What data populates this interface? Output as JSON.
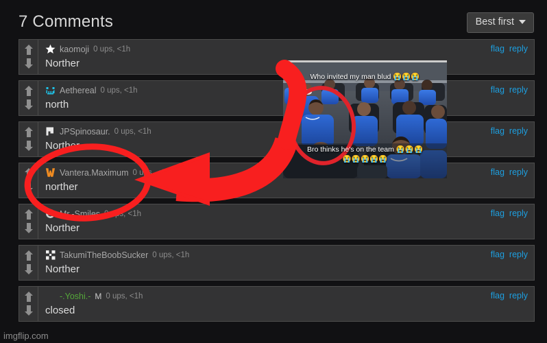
{
  "header": {
    "title": "7 Comments",
    "sort_label": "Best first",
    "sort_icon": "chevron-down-icon"
  },
  "actions": {
    "flag_label": "flag",
    "reply_label": "reply"
  },
  "comments": [
    {
      "username": "kaomoji",
      "avatar_icon": "star-avatar-icon",
      "avatar_color": "#ffffff",
      "score": "0 ups, <1h",
      "text": "Norther",
      "is_mod": false,
      "mod_badge": ""
    },
    {
      "username": "Aethereal",
      "avatar_icon": "pixel-face-avatar-icon",
      "avatar_color": "#1fc3e8",
      "score": "0 ups, <1h",
      "text": "north",
      "is_mod": false,
      "mod_badge": ""
    },
    {
      "username": "JPSpinosaur.",
      "avatar_icon": "flag-block-avatar-icon",
      "avatar_color": "#e8e8e8",
      "score": "0 ups, <1h",
      "text": "Norther",
      "is_mod": false,
      "mod_badge": ""
    },
    {
      "username": "Vantera.Maximum",
      "avatar_icon": "orange-v-avatar-icon",
      "avatar_color": "#ef8b21",
      "score": "0 ups, <1h",
      "text": "norther",
      "is_mod": false,
      "mod_badge": ""
    },
    {
      "username": "Mr.-Smiles",
      "avatar_icon": "smiley-avatar-icon",
      "avatar_color": "#cfcfcf",
      "score": "0 ups, <1h",
      "text": "Norther",
      "is_mod": false,
      "mod_badge": ""
    },
    {
      "username": "TakumiTheBoobSucker",
      "avatar_icon": "plus-cross-avatar-icon",
      "avatar_color": "#f0f0f0",
      "score": "0 ups, <1h",
      "text": "Norther",
      "is_mod": false,
      "mod_badge": ""
    },
    {
      "username": "-.Yoshi.-",
      "avatar_icon": "blank-avatar-icon",
      "avatar_color": "#55a83a",
      "score": "0 ups, <1h",
      "text": "closed",
      "is_mod": true,
      "mod_badge": "M"
    }
  ],
  "meme_overlay": {
    "top_caption": "Who invited my man blud 😭😭😭",
    "bottom_caption": "Bro thinks he's on the team 😭😭😭",
    "bottom_caption_line2": "😭😭😭😭😭",
    "alt": "football team seated in blue tracksuits, one man circled in red"
  },
  "annotation": {
    "color": "#f81f1f",
    "circle_target": "Vantera.Maximum",
    "arrow_from": "meme-overlay",
    "arrow_to": "circled-comment"
  },
  "watermark": {
    "text": "imgflip.com"
  }
}
